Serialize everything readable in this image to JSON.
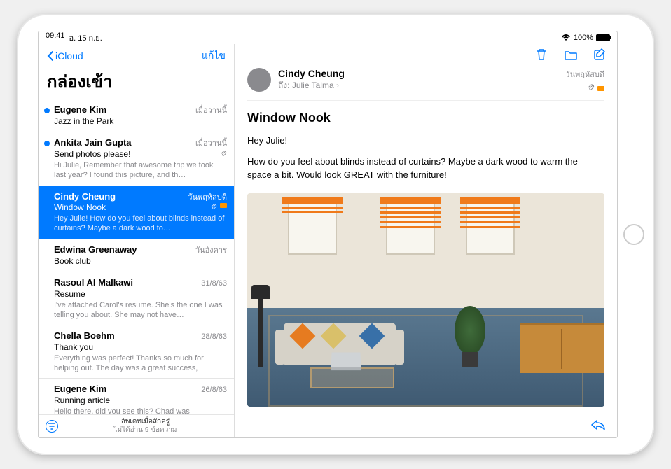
{
  "status": {
    "time": "09:41",
    "date": "อ. 15 ก.ย.",
    "battery_pct": "100%"
  },
  "sidebar": {
    "back_label": "iCloud",
    "edit_label": "แก้ไข",
    "mailbox_title": "กล่องเข้า",
    "footer_line1": "อัพเดทเมื่อสักครู่",
    "footer_line2": "ไม่ได้อ่าน 9 ข้อความ"
  },
  "messages": [
    {
      "sender": "Eugene Kim",
      "date": "เมื่อวานนี้",
      "subject": "Jazz in the Park",
      "preview": "",
      "unread": true
    },
    {
      "sender": "Ankita Jain Gupta",
      "date": "เมื่อวานนี้",
      "subject": "Send photos please!",
      "preview": "Hi Julie, Remember that awesome trip we took last year? I found this picture, and th…",
      "unread": true,
      "attachment": true
    },
    {
      "sender": "Cindy Cheung",
      "date": "วันพฤหัสบดี",
      "subject": "Window Nook",
      "preview": "Hey Julie! How do you feel about blinds instead of curtains? Maybe a dark wood to…",
      "selected": true,
      "attachment": true,
      "flag": true
    },
    {
      "sender": "Edwina Greenaway",
      "date": "วันอังคาร",
      "subject": "Book club",
      "preview": ""
    },
    {
      "sender": "Rasoul Al Malkawi",
      "date": "31/8/63",
      "subject": "Resume",
      "preview": "I've attached Carol's resume. She's the one I was telling you about. She may not have…"
    },
    {
      "sender": "Chella Boehm",
      "date": "28/8/63",
      "subject": "Thank you",
      "preview": "Everything was perfect! Thanks so much for helping out. The day was a great success,"
    },
    {
      "sender": "Eugene Kim",
      "date": "26/8/63",
      "subject": "Running article",
      "preview": "Hello there, did you see this? Chad was"
    }
  ],
  "mail": {
    "from": "Cindy Cheung",
    "to_label": "ถึง:",
    "to_name": "Julie Talma",
    "date": "วันพฤหัสบดี",
    "subject": "Window Nook",
    "greeting": "Hey Julie!",
    "body": "How do you feel about blinds instead of curtains? Maybe a dark wood to warm the space a bit. Would look GREAT with the furniture!"
  }
}
